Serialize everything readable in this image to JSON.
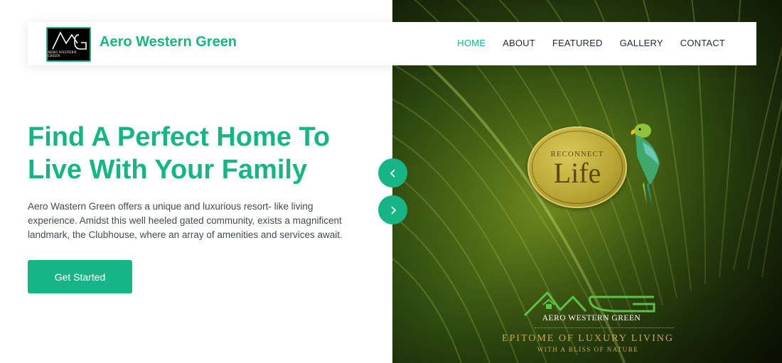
{
  "brand": {
    "name": "Aero Western Green",
    "logo_letters": "AWG",
    "logo_caption": "AERO WESTERN GREEN"
  },
  "nav": {
    "items": [
      {
        "label": "HOME",
        "active": true
      },
      {
        "label": "ABOUT",
        "active": false
      },
      {
        "label": "FEATURED",
        "active": false
      },
      {
        "label": "GALLERY",
        "active": false
      },
      {
        "label": "CONTACT",
        "active": false
      }
    ]
  },
  "hero": {
    "headline": "Find A Perfect Home To Live With Your Family",
    "description": "Aero Wastern Green offers a unique and luxurious resort- like living experience. Amidst this well heeled gated community, exists a magnificent landmark, the Clubhouse, where an array of amenities and services await.",
    "cta_label": "Get Started"
  },
  "carousel": {
    "prev_icon": "chevron-left-icon",
    "next_icon": "chevron-right-icon"
  },
  "image_overlay": {
    "badge_top": "RECONNECT",
    "badge_main": "Life",
    "awg_name": "AERO WESTERN GREEN",
    "tagline": "EPITOME OF LUXURY LIVING",
    "subtagline": "WITH A BLISS OF NATURE"
  },
  "colors": {
    "accent": "#17b486",
    "nav_text": "#1d2b3a",
    "body_text": "#444a52",
    "gold": "#c9a94a"
  }
}
